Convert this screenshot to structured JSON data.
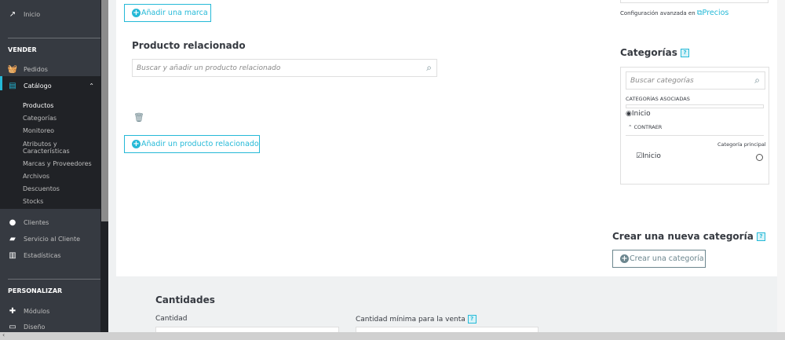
{
  "sidebar": {
    "inicio": "Inicio",
    "vender": "VENDER",
    "pedidos": "Pedidos",
    "catalogo": "Catálogo",
    "catalog_sub": [
      "Productos",
      "Categorías",
      "Monitoreo",
      "Atributos y\nCaracterísticas",
      "Marcas y Proveedores",
      "Archivos",
      "Descuentos",
      "Stocks"
    ],
    "clientes": "Clientes",
    "servicio": "Servicio al Cliente",
    "estadisticas": "Estadísticas",
    "personalizar": "PERSONALIZAR",
    "modulos": "Módulos",
    "diseno": "Diseño"
  },
  "main": {
    "add_brand": "Añadir una marca",
    "related_title": "Producto relacionado",
    "related_placeholder": "Buscar y añadir un producto relacionado",
    "add_related": "Añadir un producto relacionado",
    "quantities_title": "Cantidades",
    "quantity_label": "Cantidad",
    "min_qty_label": "Cantidad mínima para la venta"
  },
  "right": {
    "advanced_text": "Configuración avanzada en",
    "precios_link": "Precios",
    "categories_title": "Categorías",
    "search_placeholder": "Buscar categorías",
    "associated": "CATEGORÍAS ASOCIADAS",
    "tree_root": "Inicio",
    "collapse": "CONTRAER",
    "main_category": "Categoría principal",
    "tree_item": "Inicio",
    "new_category_title": "Crear una nueva categoría",
    "create_category": "Crear una categoría"
  },
  "colors": {
    "accent": "#25b9d7",
    "sidebar": "#363a41"
  }
}
